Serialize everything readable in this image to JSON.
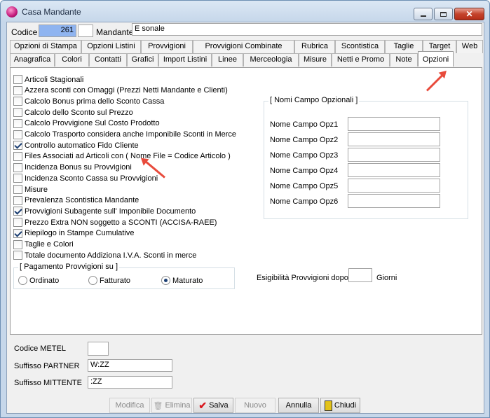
{
  "window": {
    "title": "Casa Mandante"
  },
  "header": {
    "codice_label": "Codice",
    "codice_value": "261",
    "mandante_label": "Mandante",
    "mandante_value": "E                          sonale"
  },
  "tabs_row1": [
    "Opzioni di Stampa",
    "Opzioni Listini",
    "Provvigioni",
    "Provvigioni Combinate",
    "Rubrica",
    "Scontistica",
    "Taglie",
    "Target",
    "Web"
  ],
  "tabs_row2": [
    "Anagrafica",
    "Colori",
    "Contatti",
    "Grafici",
    "Import Listini",
    "Linee",
    "Merceologia",
    "Misure",
    "Netti e Promo",
    "Note",
    "Opzioni"
  ],
  "options": [
    {
      "label": "Articoli Stagionali",
      "checked": false
    },
    {
      "label": "Azzera sconti con Omaggi (Prezzi Netti Mandante e Clienti)",
      "checked": false
    },
    {
      "label": "Calcolo Bonus prima dello Sconto Cassa",
      "checked": false
    },
    {
      "label": "Calcolo dello Sconto sul Prezzo",
      "checked": false
    },
    {
      "label": "Calcolo Provvigione Sul Costo Prodotto",
      "checked": false
    },
    {
      "label": "Calcolo Trasporto considera anche Imponibile Sconti in Merce",
      "checked": false
    },
    {
      "label": "Controllo automatico Fido Cliente",
      "checked": true
    },
    {
      "label": "Files Associati ad Articoli con ( Nome File = Codice Articolo )",
      "checked": false
    },
    {
      "label": "Incidenza Bonus su Provvigioni",
      "checked": false
    },
    {
      "label": "Incidenza Sconto Cassa su Provvigioni",
      "checked": false
    },
    {
      "label": "Misure",
      "checked": false
    },
    {
      "label": "Prevalenza Scontistica Mandante",
      "checked": false
    },
    {
      "label": "Provvigioni Subagente sull' Imponibile Documento",
      "checked": true
    },
    {
      "label": "Prezzo Extra NON soggetto a SCONTI (ACCISA-RAEE)",
      "checked": false
    },
    {
      "label": "Riepilogo in Stampe Cumulative",
      "checked": true
    },
    {
      "label": "Taglie e Colori",
      "checked": false
    },
    {
      "label": "Totale documento  Addiziona I.V.A. Sconti in merce",
      "checked": false
    }
  ],
  "pagamento": {
    "title": "[ Pagamento Provvigioni su ]",
    "options": [
      "Ordinato",
      "Fatturato",
      "Maturato"
    ],
    "selected": "Maturato"
  },
  "nomi_campo": {
    "title": "[ Nomi Campo Opzionali ]",
    "fields": [
      {
        "label": "Nome Campo Opz1",
        "value": ""
      },
      {
        "label": "Nome Campo Opz2",
        "value": ""
      },
      {
        "label": "Nome Campo Opz3",
        "value": ""
      },
      {
        "label": "Nome Campo Opz4",
        "value": ""
      },
      {
        "label": "Nome Campo Opz5",
        "value": ""
      },
      {
        "label": "Nome Campo Opz6",
        "value": ""
      }
    ]
  },
  "esigibilita": {
    "label": "Esigibilità Provvigioni dopo",
    "value": "",
    "unit": "Giorni"
  },
  "bottom": {
    "metel_label": "Codice METEL",
    "metel_value": "",
    "partner_label": "Suffisso PARTNER",
    "partner_value": "W:ZZ",
    "mittente_label": "Suffisso MITTENTE",
    "mittente_value": ":ZZ"
  },
  "buttons": {
    "modifica": "Modifica",
    "elimina": "Elimina",
    "salva": "Salva",
    "nuovo": "Nuovo",
    "annulla": "Annulla",
    "chiudi": "Chiudi"
  },
  "colors": {
    "accent": "#1c3f73",
    "code_field_bg": "#8fb4f0",
    "arrow": "#e84b3c"
  }
}
